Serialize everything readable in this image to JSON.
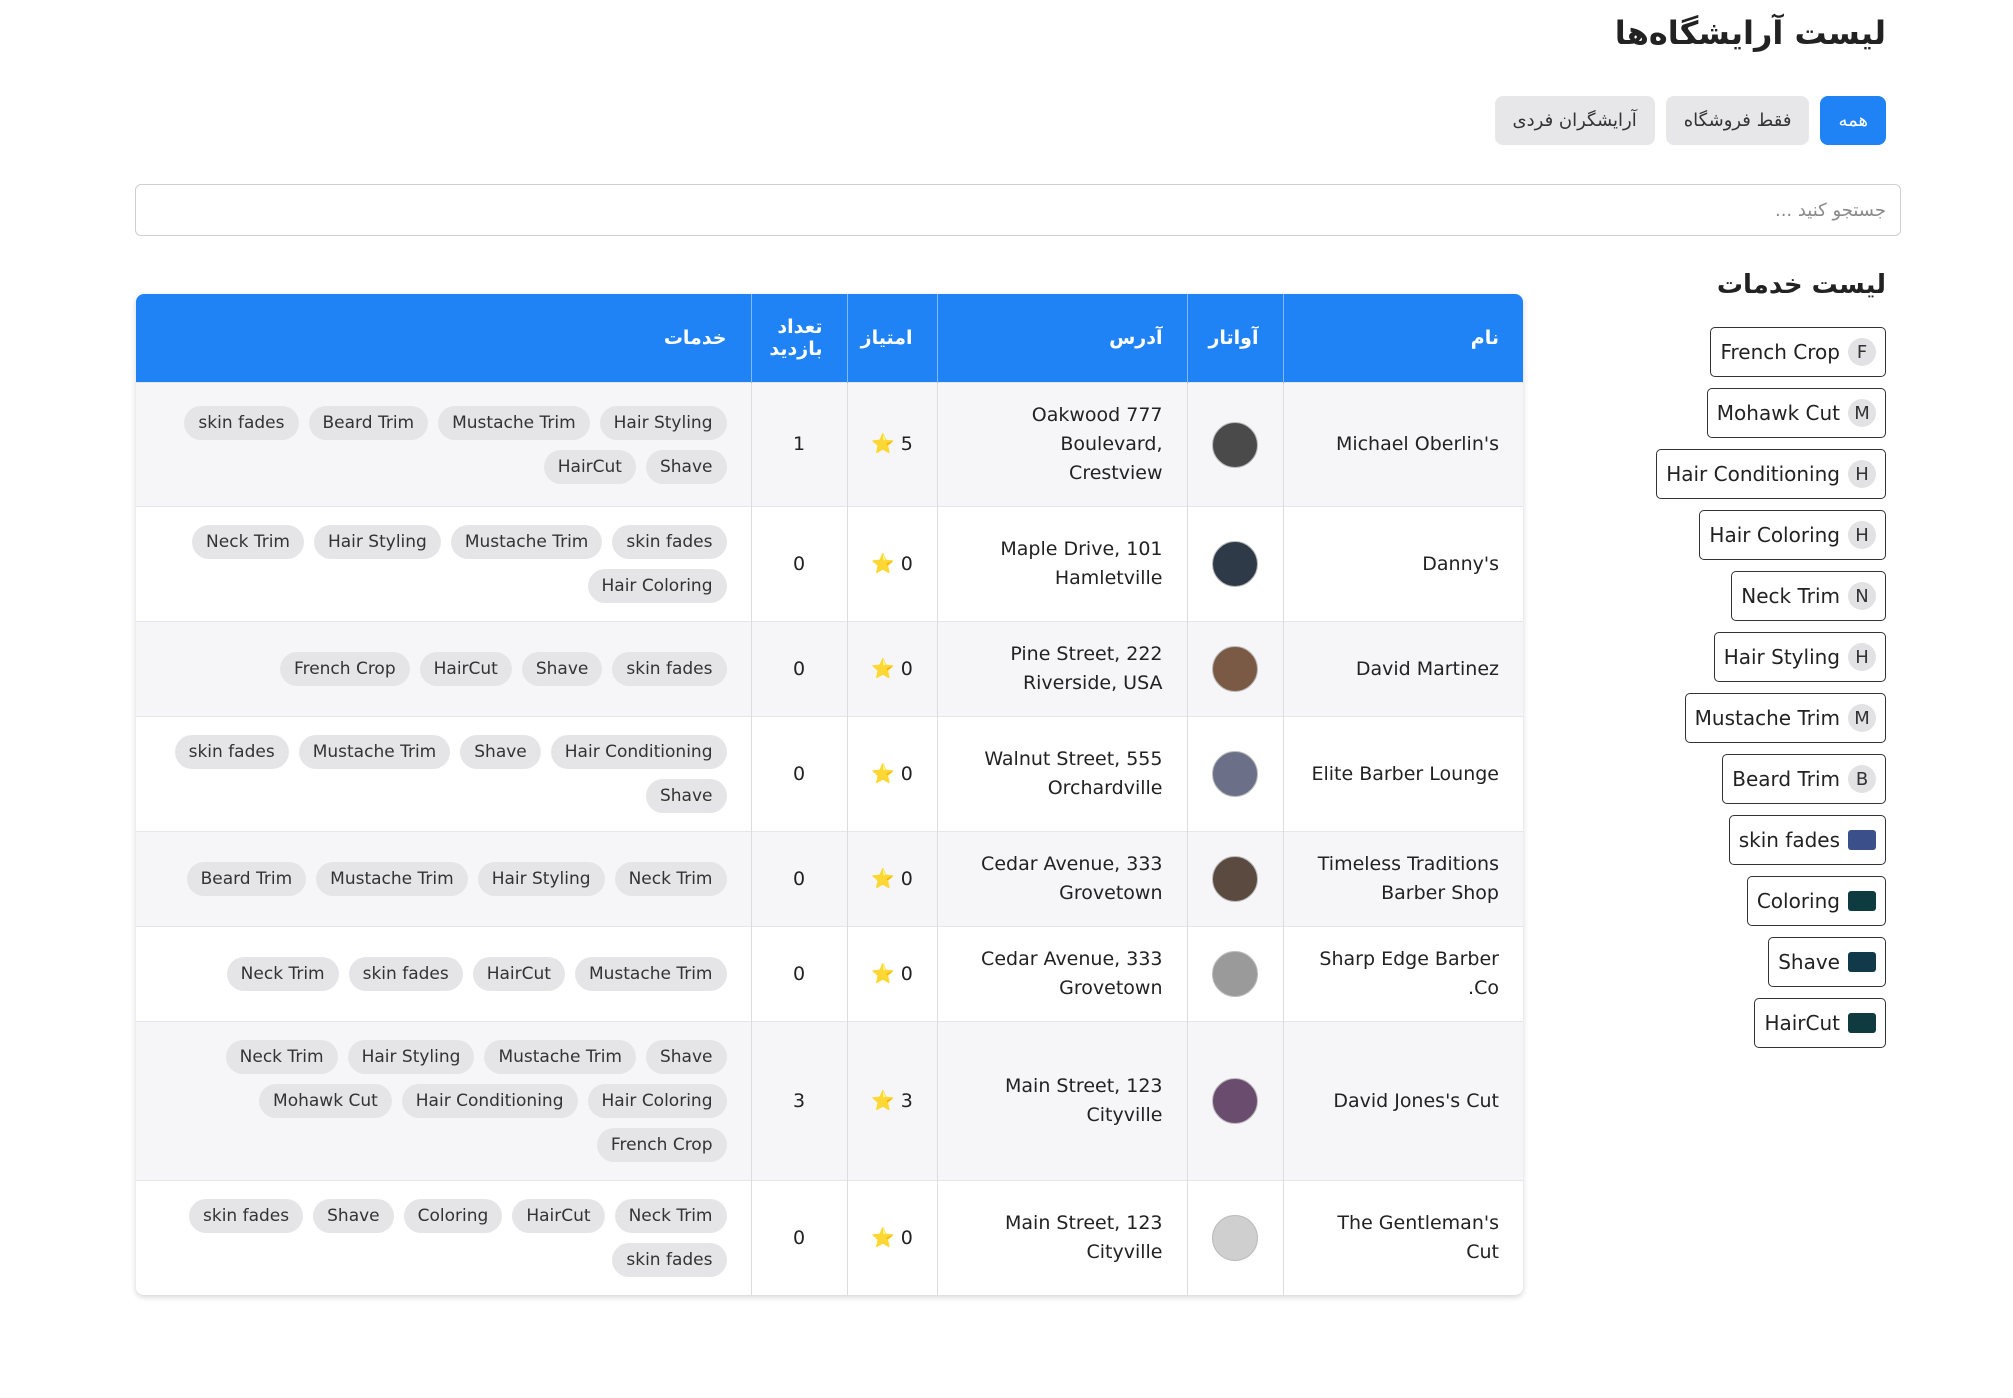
{
  "page_title": "لیست آرایشگاه‌ها",
  "filters": [
    {
      "label": "همه",
      "active": true
    },
    {
      "label": "فقط فروشگاه",
      "active": false
    },
    {
      "label": "آرایشگران فردی",
      "active": false
    }
  ],
  "search": {
    "placeholder": "جستجو کنید ...",
    "value": ""
  },
  "services": {
    "title": "لیست خدمات",
    "items": [
      {
        "label": "French Crop",
        "avatar": "F"
      },
      {
        "label": "Mohawk Cut",
        "avatar": "M"
      },
      {
        "label": "Hair Conditioning",
        "avatar": "H"
      },
      {
        "label": "Hair Coloring",
        "avatar": "H"
      },
      {
        "label": "Neck Trim",
        "avatar": "N"
      },
      {
        "label": "Hair Styling",
        "avatar": "H"
      },
      {
        "label": "Mustache Trim",
        "avatar": "M"
      },
      {
        "label": "Beard Trim",
        "avatar": "B"
      },
      {
        "label": "skin fades",
        "avatar": "",
        "image_color": "#3b4f8a"
      },
      {
        "label": "Coloring",
        "avatar": "",
        "image_color": "#0d3b3f"
      },
      {
        "label": "Shave",
        "avatar": "",
        "image_color": "#103a4a"
      },
      {
        "label": "HairCut",
        "avatar": "",
        "image_color": "#0e3a40"
      }
    ]
  },
  "table": {
    "headers": {
      "name": "نام",
      "avatar": "آواتار",
      "address": "آدرس",
      "rating": "امتیاز",
      "visits": "تعداد بازدید",
      "services": "خدمات"
    },
    "rows": [
      {
        "name": "Michael Oberlin's",
        "address": "Oakwood 777 Boulevard, Crestview",
        "rating": "5 ⭐",
        "visits": "1",
        "avatar_color": "#4a4a4a",
        "services": [
          "Hair Styling",
          "Mustache Trim",
          "Beard Trim",
          "skin fades",
          "Shave",
          "HairCut"
        ]
      },
      {
        "name": "Danny's",
        "address": "Maple Drive, 101 Hamletville",
        "rating": "0 ⭐",
        "visits": "0",
        "avatar_color": "#2e3a48",
        "services": [
          "skin fades",
          "Mustache Trim",
          "Hair Styling",
          "Neck Trim",
          "Hair Coloring"
        ]
      },
      {
        "name": "David Martinez",
        "address": "Pine Street, 222 Riverside, USA",
        "rating": "0 ⭐",
        "visits": "0",
        "avatar_color": "#7a5a45",
        "services": [
          "skin fades",
          "Shave",
          "HairCut",
          "French Crop"
        ]
      },
      {
        "name": "Elite Barber Lounge",
        "address": "Walnut Street, 555 Orchardville",
        "rating": "0 ⭐",
        "visits": "0",
        "avatar_color": "#6b7088",
        "services": [
          "Hair Conditioning",
          "Shave",
          "Mustache Trim",
          "skin fades",
          "Shave"
        ]
      },
      {
        "name": "Timeless Traditions Barber Shop",
        "address": "Cedar Avenue, 333 Grovetown",
        "rating": "0 ⭐",
        "visits": "0",
        "avatar_color": "#5a4a40",
        "services": [
          "Neck Trim",
          "Hair Styling",
          "Mustache Trim",
          "Beard Trim"
        ]
      },
      {
        "name": "Sharp Edge Barber Co.",
        "address": "Cedar Avenue, 333 Grovetown",
        "rating": "0 ⭐",
        "visits": "0",
        "avatar_color": "#9a9a9a",
        "services": [
          "Mustache Trim",
          "HairCut",
          "skin fades",
          "Neck Trim"
        ]
      },
      {
        "name": "David Jones's Cut",
        "address": "Main Street, 123 Cityville",
        "rating": "3 ⭐",
        "visits": "3",
        "avatar_color": "#6a4c6e",
        "services": [
          "Shave",
          "Mustache Trim",
          "Hair Styling",
          "Neck Trim",
          "Hair Coloring",
          "Hair Conditioning",
          "Mohawk Cut",
          "French Crop"
        ]
      },
      {
        "name": "The Gentleman's Cut",
        "address": "Main Street, 123 Cityville",
        "rating": "0 ⭐",
        "visits": "0",
        "avatar_color": "#cfcfcf",
        "services": [
          "Neck Trim",
          "HairCut",
          "Coloring",
          "Shave",
          "skin fades",
          "skin fades"
        ]
      }
    ]
  },
  "colors": {
    "accent": "#1f82f5",
    "tag_bg": "#e5e5e8",
    "star": "#f5b301"
  }
}
